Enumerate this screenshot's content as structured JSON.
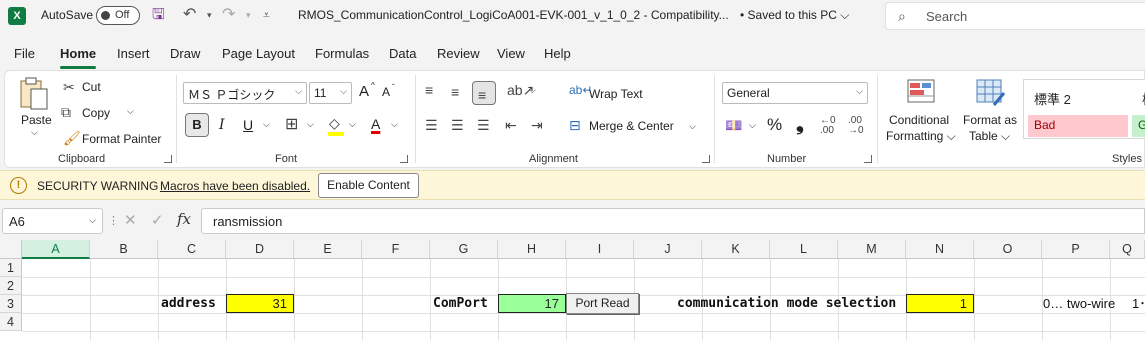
{
  "titlebar": {
    "app_icon": "X",
    "autosave_label": "AutoSave",
    "autosave_state": "Off",
    "icons": [
      "excel-logo",
      "save-icon",
      "undo-icon",
      "redo-icon",
      "customize-quick-access"
    ],
    "doc_title": "RMOS_CommunicationControl_LogiCoA001-EVK-001_v_1_0_2  -  Compatibility...",
    "saved_status": "•  Saved to this PC ⌵",
    "search_placeholder": "Search"
  },
  "menu": {
    "tabs": [
      "File",
      "Home",
      "Insert",
      "Draw",
      "Page Layout",
      "Formulas",
      "Data",
      "Review",
      "View",
      "Help"
    ],
    "active": "Home"
  },
  "ribbon": {
    "clipboard": {
      "label": "Clipboard",
      "paste": "Paste",
      "cut": "Cut",
      "copy": "Copy",
      "format_painter": "Format Painter"
    },
    "font": {
      "label": "Font",
      "font_name": "ＭＳ Ｐゴシック",
      "font_size": "11",
      "bold": "B",
      "italic": "I",
      "underline": "U",
      "grow": "A",
      "shrink": "A"
    },
    "alignment": {
      "label": "Alignment",
      "wrap_text": "Wrap Text",
      "merge_center": "Merge & Center"
    },
    "number": {
      "label": "Number",
      "format": "General",
      "percent": "%",
      "comma": "❟"
    },
    "styles": {
      "label": "Styles",
      "conditional_formatting_1": "Conditional",
      "conditional_formatting_2": "Formatting ⌵",
      "format_as_table_1": "Format as",
      "format_as_table_2": "Table ⌵",
      "style_normal2": "標準 2",
      "style_bad": "Bad",
      "style_next": "標",
      "colors": {
        "bad_bg": "#ffc7ce",
        "bad_text": "#9c0006",
        "good_bg": "#c6efce",
        "good_text": "#006100"
      }
    }
  },
  "security": {
    "title": "SECURITY WARNING",
    "message": "Macros have been disabled.",
    "button": "Enable Content"
  },
  "formula_bar": {
    "name_box": "A6",
    "fx": "fx",
    "content": "ransmission"
  },
  "grid": {
    "columns": [
      "A",
      "D",
      "E",
      "B",
      "C",
      "D",
      "E",
      "F",
      "G",
      "H",
      "I",
      "J",
      "K",
      "L",
      "M",
      "N",
      "O",
      "P",
      "G"
    ],
    "column_labels": [
      "A",
      "B",
      "C",
      "D",
      "E",
      "F",
      "G",
      "H",
      "I",
      "J",
      "K",
      "L",
      "M",
      "N",
      "O",
      "P",
      "Q"
    ],
    "rows": [
      "1",
      "2",
      "3",
      "4"
    ],
    "cells": {
      "address_label": "address",
      "address_value": "31",
      "comport_label": "ComPort",
      "comport_value": "17",
      "port_read_button": "Port Read",
      "mode_label": "communication mode selection",
      "mode_value": "1",
      "mode_note": "0… two-wire",
      "mode_note2": "1･"
    },
    "colors": {
      "yellow": "#ffff00",
      "green": "#99ff99",
      "accent": "#107c41"
    }
  }
}
